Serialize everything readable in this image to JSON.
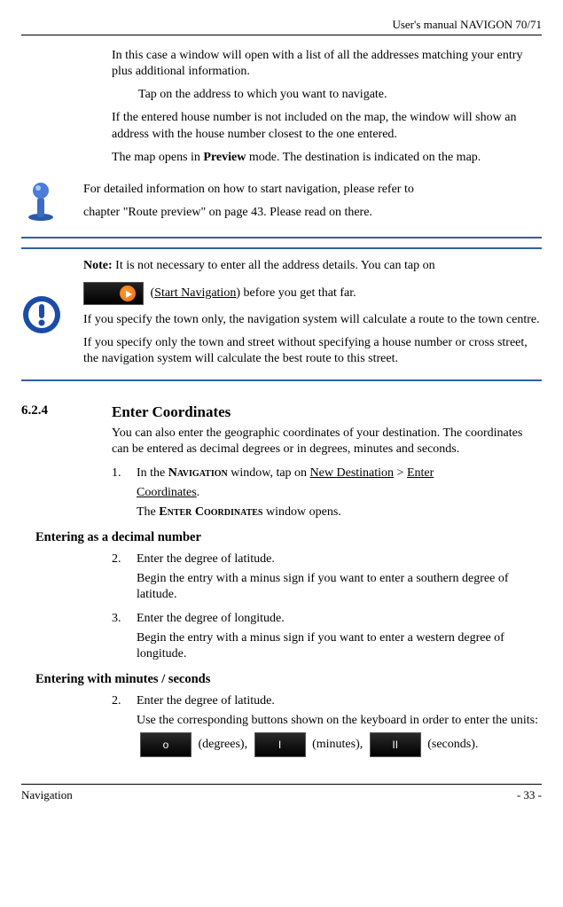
{
  "header": {
    "title": "User's manual NAVIGON 70/71"
  },
  "intro": {
    "p1": "In this case a window will open with a list of all the addresses matching your entry plus additional information.",
    "p2": "Tap on the address to which you want to navigate.",
    "p3": "If the entered house number is not included on the map, the window will show an address with the house number closest to the one entered.",
    "p4a": "The map opens in ",
    "p4b": "Preview",
    "p4c": " mode. The destination is indicated on the map."
  },
  "info": {
    "line1": "For detailed information on how to start navigation, please refer to",
    "line2": "chapter \"Route preview\" on page 43. Please read on there."
  },
  "note": {
    "lead": "Note:",
    "p1": " It is not necessary to enter all the address details. You can tap on",
    "start_nav": "Start Navigation",
    "p1b": " before you get that far.",
    "p2": "If you specify the town only, the navigation system will calculate a route to the town centre.",
    "p3": "If you specify only the town and street without specifying a house number or cross street, the navigation system will calculate the best route to this street."
  },
  "section": {
    "num": "6.2.4",
    "title": "Enter Coordinates",
    "intro": "You can also enter the geographic coordinates of your destination. The coordinates can be entered as decimal degrees or in degrees, minutes and seconds.",
    "step1_num": "1.",
    "step1a": "In the ",
    "step1_nav": "Navigation",
    "step1b": " window, tap on ",
    "step1_link1": "New Destination",
    "step1_gt": " > ",
    "step1_link2a": "Enter",
    "step1_link2b": "Coordinates",
    "step1_period": ".",
    "step1_after_a": "The ",
    "step1_after_b": "Enter Coordinates",
    "step1_after_c": " window opens.",
    "sub1": "Entering as a decimal number",
    "s1_step2_num": "2.",
    "s1_step2": "Enter the degree of latitude.",
    "s1_step2b": "Begin the entry with a minus sign if you want to enter a southern degree of latitude.",
    "s1_step3_num": "3.",
    "s1_step3": "Enter the degree of longitude.",
    "s1_step3b": "Begin the entry with a minus sign if you want to enter a western degree of longitude.",
    "sub2": "Entering with minutes / seconds",
    "s2_step2_num": "2.",
    "s2_step2": "Enter the degree of latitude.",
    "s2_step2b": "Use the corresponding buttons shown on the keyboard in order to enter the units:",
    "deg_label": " (degrees), ",
    "min_label": " (minutes), ",
    "sec_label": " (seconds).",
    "deg_sym": "o",
    "min_sym": "I",
    "sec_sym": "II"
  },
  "footer": {
    "left": "Navigation",
    "right": "- 33 -"
  }
}
